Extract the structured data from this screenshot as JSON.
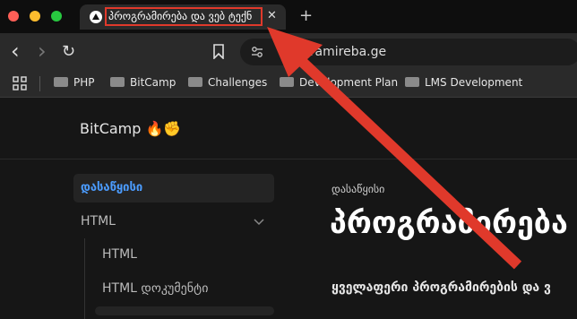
{
  "window": {
    "dots": [
      "#fe5f57",
      "#febc2e",
      "#28c840"
    ]
  },
  "tab": {
    "title": "პროგრამირება და ვებ ტექნ",
    "close": "✕",
    "new_tab": "+"
  },
  "toolbar": {
    "back": "‹",
    "forward": "›",
    "reload": "↻",
    "url": "programireba.ge"
  },
  "bookmarks": [
    "PHP",
    "BitCamp",
    "Challenges",
    "Development Plan",
    "LMS Development"
  ],
  "site": {
    "logo": "BitCamp 🔥✊"
  },
  "sidebar": {
    "active": "დასაწყისი",
    "items": [
      "HTML",
      "HTML",
      "HTML დოკუმენტი"
    ]
  },
  "content": {
    "breadcrumb": "დასაწყისი",
    "heading": "პროგრამირება",
    "paragraph": "ყველაფერი პროგრამირების და ვ"
  },
  "annotation_color": "#e0392b"
}
